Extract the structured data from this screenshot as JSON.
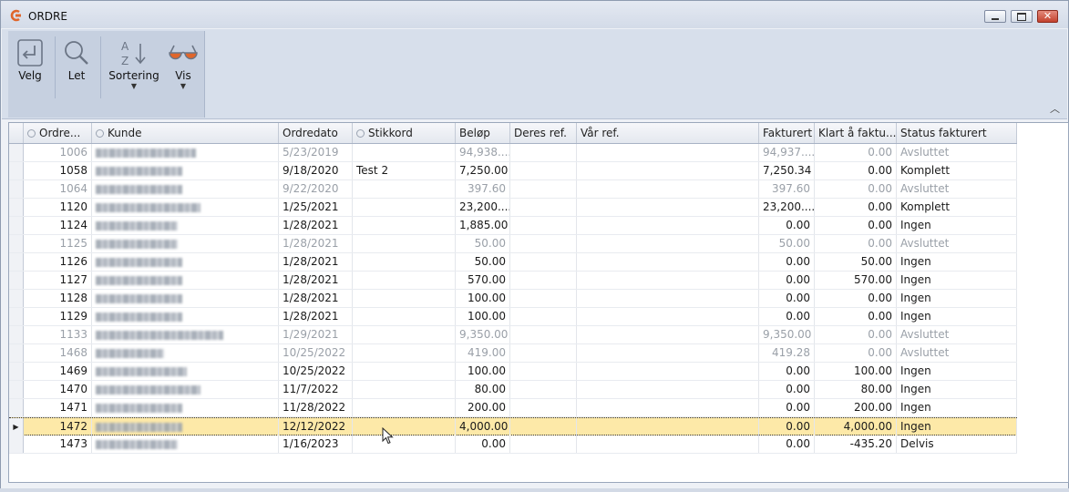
{
  "window": {
    "title": "ORDRE",
    "minimize_icon": "minimize-icon",
    "maximize_icon": "maximize-icon",
    "close_icon": "close-icon",
    "close_glyph": "✕"
  },
  "ribbon": {
    "buttons": [
      {
        "label": "Velg",
        "icon": "select-return-icon"
      },
      {
        "label": "Let",
        "icon": "magnifier-icon"
      },
      {
        "label": "Sortering",
        "icon": "sort-az-icon",
        "arrow": "▼"
      },
      {
        "label": "Vis",
        "icon": "glasses-icon",
        "arrow": "▼"
      }
    ],
    "collapse_glyph": "︿"
  },
  "grid": {
    "columns": [
      "Ordre...",
      "Kunde",
      "Ordredato",
      "Stikkord",
      "Beløp",
      "Deres ref.",
      "Vår ref.",
      "Fakturert",
      "Klart å faktu...",
      "Status fakturert"
    ],
    "rows": [
      {
        "ordre": "1006",
        "dato": "5/23/2019",
        "stikkord": "",
        "belop": "94,938....",
        "fakturert": "94,937....",
        "klart": "0.00",
        "status": "Avsluttet",
        "gray": true
      },
      {
        "ordre": "1058",
        "dato": "9/18/2020",
        "stikkord": "Test 2",
        "belop": "7,250.00",
        "fakturert": "7,250.34",
        "klart": "0.00",
        "status": "Komplett",
        "gray": false
      },
      {
        "ordre": "1064",
        "dato": "9/22/2020",
        "stikkord": "",
        "belop": "397.60",
        "fakturert": "397.60",
        "klart": "0.00",
        "status": "Avsluttet",
        "gray": true
      },
      {
        "ordre": "1120",
        "dato": "1/25/2021",
        "stikkord": "",
        "belop": "23,200....",
        "fakturert": "23,200....",
        "klart": "0.00",
        "status": "Komplett",
        "gray": false
      },
      {
        "ordre": "1124",
        "dato": "1/28/2021",
        "stikkord": "",
        "belop": "1,885.00",
        "fakturert": "0.00",
        "klart": "0.00",
        "status": "Ingen",
        "gray": false
      },
      {
        "ordre": "1125",
        "dato": "1/28/2021",
        "stikkord": "",
        "belop": "50.00",
        "fakturert": "50.00",
        "klart": "0.00",
        "status": "Avsluttet",
        "gray": true
      },
      {
        "ordre": "1126",
        "dato": "1/28/2021",
        "stikkord": "",
        "belop": "50.00",
        "fakturert": "0.00",
        "klart": "50.00",
        "status": "Ingen",
        "gray": false
      },
      {
        "ordre": "1127",
        "dato": "1/28/2021",
        "stikkord": "",
        "belop": "570.00",
        "fakturert": "0.00",
        "klart": "570.00",
        "status": "Ingen",
        "gray": false
      },
      {
        "ordre": "1128",
        "dato": "1/28/2021",
        "stikkord": "",
        "belop": "100.00",
        "fakturert": "0.00",
        "klart": "0.00",
        "status": "Ingen",
        "gray": false
      },
      {
        "ordre": "1129",
        "dato": "1/28/2021",
        "stikkord": "",
        "belop": "100.00",
        "fakturert": "0.00",
        "klart": "0.00",
        "status": "Ingen",
        "gray": false
      },
      {
        "ordre": "1133",
        "dato": "1/29/2021",
        "stikkord": "",
        "belop": "9,350.00",
        "fakturert": "9,350.00",
        "klart": "0.00",
        "status": "Avsluttet",
        "gray": true
      },
      {
        "ordre": "1468",
        "dato": "10/25/2022",
        "stikkord": "",
        "belop": "419.00",
        "fakturert": "419.28",
        "klart": "0.00",
        "status": "Avsluttet",
        "gray": true
      },
      {
        "ordre": "1469",
        "dato": "10/25/2022",
        "stikkord": "",
        "belop": "100.00",
        "fakturert": "0.00",
        "klart": "100.00",
        "status": "Ingen",
        "gray": false
      },
      {
        "ordre": "1470",
        "dato": "11/7/2022",
        "stikkord": "",
        "belop": "80.00",
        "fakturert": "0.00",
        "klart": "80.00",
        "status": "Ingen",
        "gray": false
      },
      {
        "ordre": "1471",
        "dato": "11/28/2022",
        "stikkord": "",
        "belop": "200.00",
        "fakturert": "0.00",
        "klart": "200.00",
        "status": "Ingen",
        "gray": false
      },
      {
        "ordre": "1472",
        "dato": "12/12/2022",
        "stikkord": "",
        "belop": "4,000.00",
        "fakturert": "0.00",
        "klart": "4,000.00",
        "status": "Ingen",
        "gray": false,
        "selected": true
      },
      {
        "ordre": "1473",
        "dato": "1/16/2023",
        "stikkord": "",
        "belop": "0.00",
        "fakturert": "0.00",
        "klart": "-435.20",
        "status": "Delvis",
        "gray": false
      }
    ]
  },
  "colors": {
    "accent": "#e0662b",
    "selected_row": "#fde9a8",
    "ribbon": "#d7dfeb"
  }
}
